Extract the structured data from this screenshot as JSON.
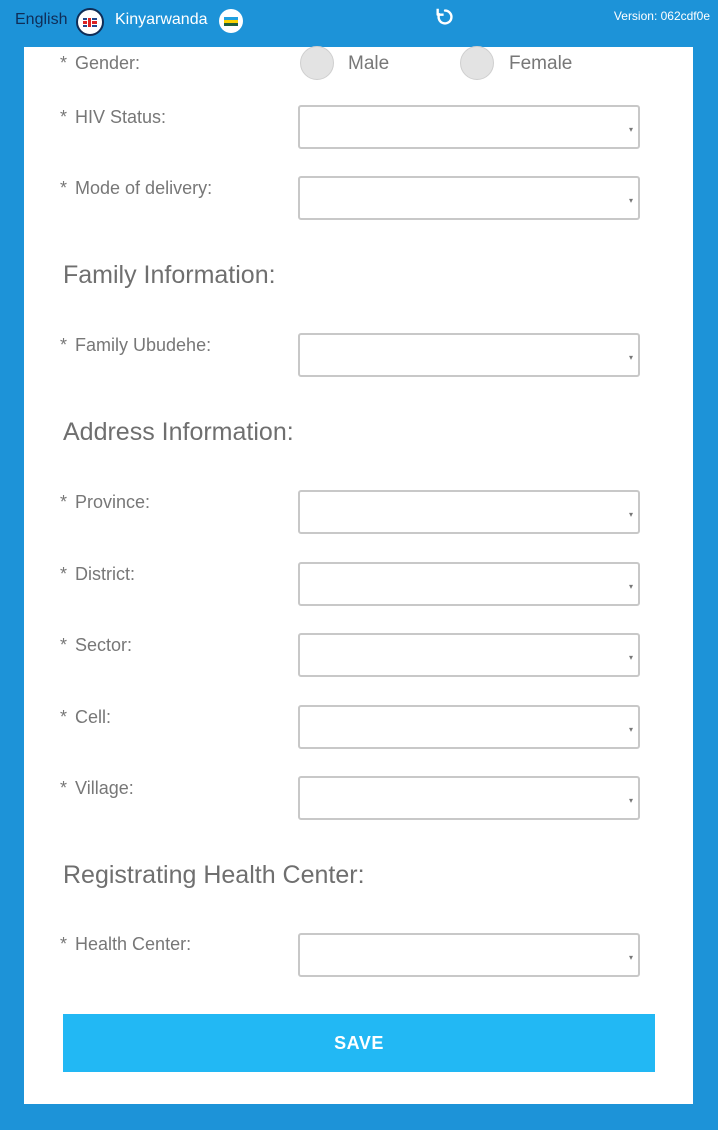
{
  "header": {
    "lang_english": "English",
    "lang_kinyarwanda": "Kinyarwanda",
    "version": "Version: 062cdf0e",
    "colors": {
      "bar": "#1d93d8",
      "english_text": "#0f2d57"
    }
  },
  "form": {
    "gender": {
      "required": "*",
      "label": "Gender:",
      "options": [
        "Male",
        "Female"
      ],
      "selected": ""
    },
    "hiv_status": {
      "required": "*",
      "label": "HIV Status:",
      "value": ""
    },
    "mode_of_delivery": {
      "required": "*",
      "label": "Mode of delivery:",
      "value": ""
    },
    "family_section_title": "Family Information:",
    "family_ubudehe": {
      "required": "*",
      "label": "Family Ubudehe:",
      "value": ""
    },
    "address_section_title": "Address Information:",
    "province": {
      "required": "*",
      "label": "Province:",
      "value": ""
    },
    "district": {
      "required": "*",
      "label": "District:",
      "value": ""
    },
    "sector": {
      "required": "*",
      "label": "Sector:",
      "value": ""
    },
    "cell": {
      "required": "*",
      "label": "Cell:",
      "value": ""
    },
    "village": {
      "required": "*",
      "label": "Village:",
      "value": ""
    },
    "health_section_title": "Registrating Health Center:",
    "health_center": {
      "required": "*",
      "label": "Health Center:",
      "value": ""
    },
    "save_label": "SAVE",
    "caret": "▾"
  },
  "icons": {
    "uk_flag": "flag-uk-icon",
    "rw_flag": "flag-rw-icon",
    "refresh": "refresh-icon",
    "dropdown": "chevron-down-icon"
  }
}
